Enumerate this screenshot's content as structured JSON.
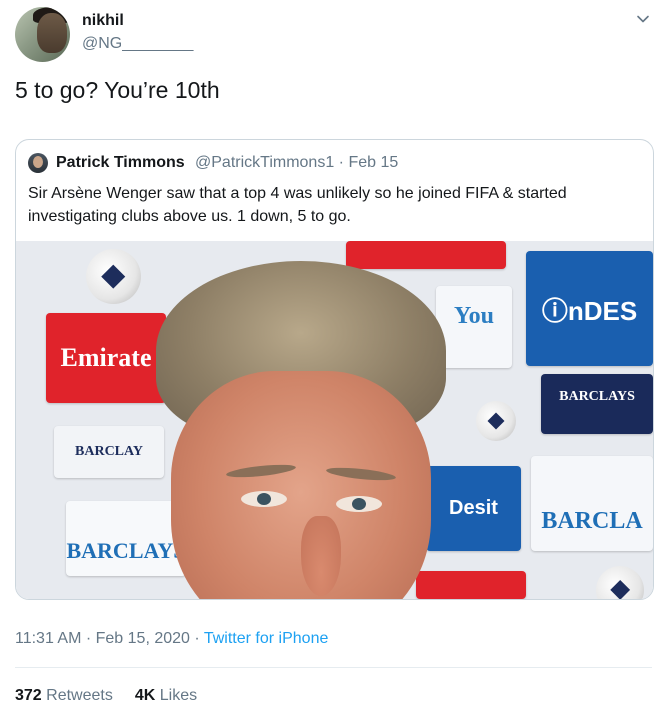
{
  "author": {
    "name": "nikhil",
    "handle": "@NG________"
  },
  "tweet": {
    "text": "5 to go? You’re 10th",
    "timestamp": "11:31 AM · Feb 15, 2020 · ",
    "source": "Twitter for iPhone"
  },
  "quoted_tweet": {
    "author_name": "Patrick Timmons",
    "author_handle_date": "@PatrickTimmons1 · Feb 15",
    "text": "Sir Arsène Wenger saw that a top 4 was unlikely so he joined FIFA & started investigating clubs above us. 1 down, 5 to go.",
    "image_boards": {
      "emirates": "Emirate",
      "barclays_small": "BARCLAY",
      "barclays_large": "BARCLAYS",
      "you": "You",
      "indesit": "ⓘnDES",
      "barclays_premier": "BARCLAYS",
      "desit": "Desit",
      "barcla": "BARCLA"
    }
  },
  "stats": {
    "retweets_count": "372",
    "retweets_label": "Retweets",
    "likes_count": "4K",
    "likes_label": "Likes"
  },
  "icons": {
    "caret": "chevron-down-icon"
  },
  "colors": {
    "text_primary": "#14171a",
    "text_secondary": "#657786",
    "link": "#1da1f2",
    "border": "#ccd6dd"
  }
}
